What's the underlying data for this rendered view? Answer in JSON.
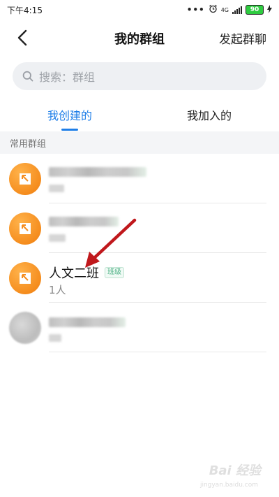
{
  "status_bar": {
    "time": "下午4:15",
    "dots": "•••",
    "network": "4G",
    "battery": "90"
  },
  "nav": {
    "title": "我的群组",
    "action": "发起群聊"
  },
  "search": {
    "placeholder": "搜索：群组"
  },
  "tabs": [
    {
      "label": "我创建的",
      "active": true
    },
    {
      "label": "我加入的",
      "active": false
    }
  ],
  "section": {
    "title": "常用群组"
  },
  "groups": [
    {
      "name": "",
      "members": "",
      "blurred": true
    },
    {
      "name": "",
      "members": "",
      "blurred": true
    },
    {
      "name": "人文二班",
      "badge": "班级",
      "members": "1人",
      "blurred": false
    },
    {
      "name": "",
      "members": "",
      "blurred": true
    }
  ],
  "watermark": {
    "main": "Bai 经验",
    "sub": "jingyan.baidu.com"
  },
  "colors": {
    "accent": "#1e7ee8",
    "avatar_orange": "#f58d1e",
    "annotation_arrow": "#c0181c"
  }
}
